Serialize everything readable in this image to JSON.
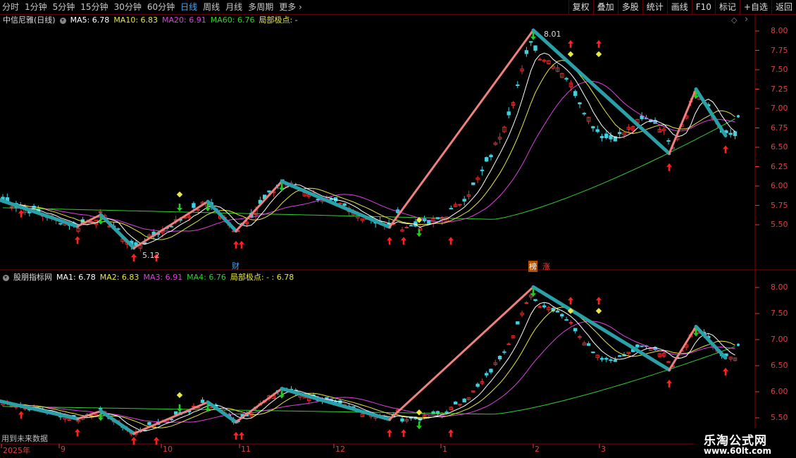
{
  "toolbar": {
    "left": [
      "分时",
      "1分钟",
      "5分钟",
      "15分钟",
      "30分钟",
      "60分钟",
      "日线",
      "周线",
      "月线",
      "多周期",
      "更多 ›"
    ],
    "active": "日线",
    "right": [
      "复权",
      "叠加",
      "多股",
      "统计",
      "画线",
      "F10",
      "标记",
      "+自选",
      "返回"
    ]
  },
  "panel1": {
    "stock_name": "中信尼雅(日线)",
    "ma5": "MA5: 6.78",
    "ma10": "MA10: 6.83",
    "ma20": "MA20: 6.91",
    "ma60": "MA60: 6.76",
    "local_extreme": "局部极点: -",
    "diamond": "◇",
    "gt": "›"
  },
  "panel2": {
    "indicator_name": "股朋指标网",
    "ma1": "MA1: 6.78",
    "ma2": "MA2: 6.83",
    "ma3": "MA3: 6.91",
    "ma4": "MA4: 6.76",
    "local_extreme": "局部极点: - : 6.78"
  },
  "annotations": {
    "high": "8.01",
    "low": "5.12",
    "cai": "财",
    "bang": "榜",
    "zhang": "涨",
    "future": "用到未来数据"
  },
  "axis_top": [
    "8.00",
    "7.75",
    "7.50",
    "7.25",
    "7.00",
    "6.75",
    "6.50",
    "6.25",
    "6.00",
    "5.75",
    "5.50"
  ],
  "axis_bottom": [
    "8.00",
    "7.50",
    "7.00",
    "6.50",
    "6.00",
    "5.50"
  ],
  "x_axis": [
    "2025年",
    "9",
    "10",
    "11",
    "12",
    "1",
    "2",
    "3"
  ],
  "watermark": {
    "line1": "乐淘公式网",
    "line2": "www.60lt.com"
  },
  "colors": {
    "ma5": "#ffffff",
    "ma10": "#e8e840",
    "ma20": "#e040e0",
    "ma60": "#30d030",
    "zigzag_up": "#f08080",
    "zigzag_down": "#2aa0a8",
    "up": "#e03030",
    "down": "#40d0e0",
    "axis": "#e04040"
  }
}
